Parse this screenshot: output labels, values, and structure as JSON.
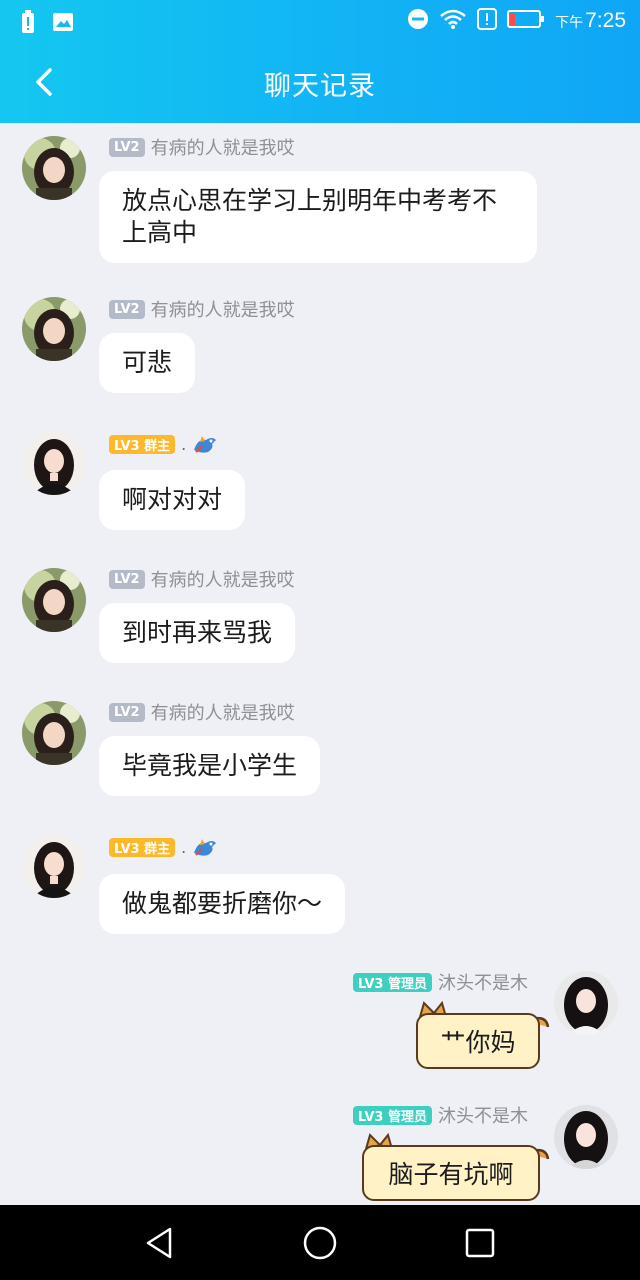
{
  "status_bar": {
    "time_prefix": "下午",
    "time": "7:25"
  },
  "header": {
    "title": "聊天记录"
  },
  "messages": [
    {
      "side": "left",
      "badge": "LV2",
      "name": "有病的人就是我哎",
      "text": "放点心思在学习上别明年中考考不上高中"
    },
    {
      "side": "left",
      "badge": "LV2",
      "name": "有病的人就是我哎",
      "text": "可悲"
    },
    {
      "side": "left",
      "badge": "LV3 群主",
      "name": ".",
      "text": "啊对对对"
    },
    {
      "side": "left",
      "badge": "LV2",
      "name": "有病的人就是我哎",
      "text": "到时再来骂我"
    },
    {
      "side": "left",
      "badge": "LV2",
      "name": "有病的人就是我哎",
      "text": "毕竟我是小学生"
    },
    {
      "side": "left",
      "badge": "LV3 群主",
      "name": ".",
      "text": "做鬼都要折磨你～"
    },
    {
      "side": "right",
      "badge": "LV3 管理员",
      "name": "沐头不是木",
      "text": "艹你妈"
    },
    {
      "side": "right",
      "badge": "LV3 管理员",
      "name": "沐头不是木",
      "text": "脑子有坑啊"
    }
  ],
  "icons": {
    "back": "chevron-left-icon",
    "nav_back": "triangle-back-icon",
    "nav_home": "circle-home-icon",
    "nav_recent": "square-recent-icon"
  },
  "colors": {
    "header_start": "#14c7f0",
    "header_end": "#0fa6f6",
    "lv2_badge": "#b3bac8",
    "owner_badge": "#fdb82b",
    "admin_badge": "#3ecfc0",
    "chat_bg": "#eef0f5"
  }
}
